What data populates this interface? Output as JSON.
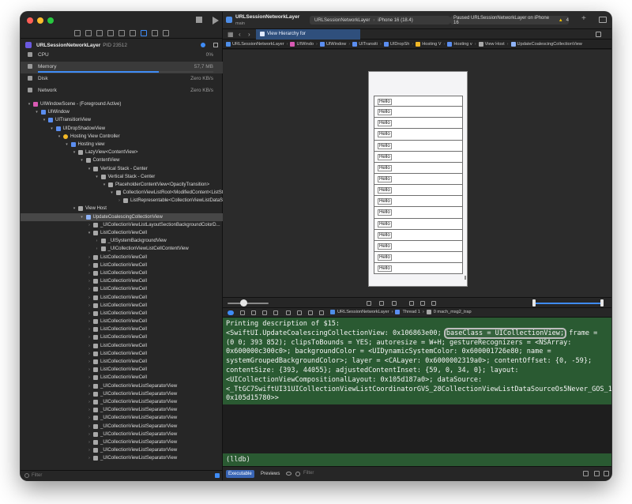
{
  "colors": {
    "accent": "#3f8cf6",
    "console_bg": "#2a5a32",
    "warning": "#f2c200"
  },
  "left": {
    "process": {
      "name": "URLSessionNetworkLayer",
      "pid": "PID 23512"
    },
    "gauges": [
      {
        "label": "CPU",
        "value": "0%",
        "level": 0.0
      },
      {
        "label": "Memory",
        "value": "57,7 MB",
        "level": 0.85
      },
      {
        "label": "Disk",
        "value": "Zero KB/s",
        "level": 0.0
      },
      {
        "label": "Network",
        "value": "Zero KB/s",
        "level": 0.0
      }
    ],
    "tree": [
      {
        "label": "UIWindowScene - (Foreground Active)",
        "depth": 0,
        "open": true,
        "icon": "pink"
      },
      {
        "label": "UIWindow",
        "depth": 1,
        "open": true,
        "icon": "blue"
      },
      {
        "label": "UITransitionView",
        "depth": 2,
        "open": true,
        "icon": "blue"
      },
      {
        "label": "UIDropShadowView",
        "depth": 3,
        "open": true,
        "icon": "blue"
      },
      {
        "label": "Hosting View Controller",
        "depth": 4,
        "open": true,
        "icon": "yellow"
      },
      {
        "label": "Hosting view",
        "depth": 5,
        "open": true,
        "icon": "blue"
      },
      {
        "label": "LazyView<ContentView>",
        "depth": 6,
        "open": true,
        "icon": "gray"
      },
      {
        "label": "ContentView",
        "depth": 7,
        "open": true,
        "icon": "gray"
      },
      {
        "label": "Vertical Stack - Center",
        "depth": 8,
        "open": true,
        "icon": "gray"
      },
      {
        "label": "Vertical Stack - Center",
        "depth": 9,
        "open": true,
        "icon": "gray"
      },
      {
        "label": "PlaceholderContentView<OpacityTransition>",
        "depth": 10,
        "open": true,
        "icon": "gray"
      },
      {
        "label": "CollectionViewListRoot<ModifiedContent<ListSt...",
        "depth": 11,
        "open": true,
        "icon": "gray"
      },
      {
        "label": "ListRepresentable<CollectionViewListDataSo...",
        "depth": 12,
        "open": false,
        "icon": "gray"
      },
      {
        "label": "View Host",
        "depth": 6,
        "open": true,
        "icon": "gray"
      },
      {
        "label": "UpdateCoalescingCollectionView",
        "depth": 7,
        "open": true,
        "icon": "grid",
        "selected": true
      },
      {
        "label": "_UICollectionViewListLayoutSectionBackgroundColorD...",
        "depth": 8,
        "open": false,
        "icon": "gray"
      },
      {
        "label": "ListCollectionViewCell",
        "depth": 8,
        "open": true,
        "icon": "gray"
      },
      {
        "label": "_UISystemBackgroundView",
        "depth": 9,
        "open": false,
        "icon": "gray"
      },
      {
        "label": "_UICollectionViewListCellContentView",
        "depth": 9,
        "open": false,
        "icon": "gray"
      },
      {
        "label": "ListCollectionViewCell",
        "depth": 8,
        "open": false,
        "icon": "gray"
      },
      {
        "label": "ListCollectionViewCell",
        "depth": 8,
        "open": false,
        "icon": "gray"
      },
      {
        "label": "ListCollectionViewCell",
        "depth": 8,
        "open": false,
        "icon": "gray"
      },
      {
        "label": "ListCollectionViewCell",
        "depth": 8,
        "open": false,
        "icon": "gray"
      },
      {
        "label": "ListCollectionViewCell",
        "depth": 8,
        "open": false,
        "icon": "gray"
      },
      {
        "label": "ListCollectionViewCell",
        "depth": 8,
        "open": false,
        "icon": "gray"
      },
      {
        "label": "ListCollectionViewCell",
        "depth": 8,
        "open": false,
        "icon": "gray"
      },
      {
        "label": "ListCollectionViewCell",
        "depth": 8,
        "open": false,
        "icon": "gray"
      },
      {
        "label": "ListCollectionViewCell",
        "depth": 8,
        "open": false,
        "icon": "gray"
      },
      {
        "label": "ListCollectionViewCell",
        "depth": 8,
        "open": false,
        "icon": "gray"
      },
      {
        "label": "ListCollectionViewCell",
        "depth": 8,
        "open": false,
        "icon": "gray"
      },
      {
        "label": "ListCollectionViewCell",
        "depth": 8,
        "open": false,
        "icon": "gray"
      },
      {
        "label": "ListCollectionViewCell",
        "depth": 8,
        "open": false,
        "icon": "gray"
      },
      {
        "label": "ListCollectionViewCell",
        "depth": 8,
        "open": false,
        "icon": "gray"
      },
      {
        "label": "ListCollectionViewCell",
        "depth": 8,
        "open": false,
        "icon": "gray"
      },
      {
        "label": "ListCollectionViewCell",
        "depth": 8,
        "open": false,
        "icon": "gray"
      },
      {
        "label": "_UICollectionViewListSeparatorView",
        "depth": 8,
        "open": false,
        "icon": "gray"
      },
      {
        "label": "_UICollectionViewListSeparatorView",
        "depth": 8,
        "open": false,
        "icon": "gray"
      },
      {
        "label": "_UICollectionViewListSeparatorView",
        "depth": 8,
        "open": false,
        "icon": "gray"
      },
      {
        "label": "_UICollectionViewListSeparatorView",
        "depth": 8,
        "open": false,
        "icon": "gray"
      },
      {
        "label": "_UICollectionViewListSeparatorView",
        "depth": 8,
        "open": false,
        "icon": "gray"
      },
      {
        "label": "_UICollectionViewListSeparatorView",
        "depth": 8,
        "open": false,
        "icon": "gray"
      },
      {
        "label": "_UICollectionViewListSeparatorView",
        "depth": 8,
        "open": false,
        "icon": "gray"
      },
      {
        "label": "_UICollectionViewListSeparatorView",
        "depth": 8,
        "open": false,
        "icon": "gray"
      },
      {
        "label": "_UICollectionViewListSeparatorView",
        "depth": 8,
        "open": false,
        "icon": "gray"
      },
      {
        "label": "_UICollectionViewListSeparatorView",
        "depth": 8,
        "open": false,
        "icon": "gray"
      }
    ],
    "filter_placeholder": "Filter"
  },
  "toolbar": {
    "project": "URLSessionNetworkLayer",
    "branch": "main",
    "scheme": "URLSessionNetworkLayer",
    "device": "iPhone 16 (18.4)",
    "status": "Paused URLSessionNetworkLayer on iPhone 16",
    "warnings": "4"
  },
  "tab": {
    "label": "View Hierarchy for URLSessionNetworkLayer"
  },
  "jumpbar": [
    "URLSessionNetworkLayer",
    "UIWindo",
    "UIWindow",
    "UITransiti",
    "UIDropSh",
    "Hosting V",
    "Hosting v",
    "View Host",
    "UpdateCoalescingCollectionView"
  ],
  "phone": {
    "cells": [
      "Hello",
      "Hello",
      "Hello",
      "Hello",
      "Hello",
      "Hello",
      "Hello",
      "Hello",
      "Hello",
      "Hello",
      "Hello",
      "Hello",
      "Hello",
      "Hello",
      "Hello",
      "Hello"
    ]
  },
  "debugbar": {
    "crumbs": [
      "URLSessionNetworkLayer",
      "Thread 1",
      "0 mach_msg2_trap"
    ]
  },
  "console": {
    "header": "Printing description of $15:",
    "line1_pre": "<SwiftUI.UpdateCoalescingCollectionView: 0x106863e00; ",
    "line1_hl": "baseClass = UICollectionView;",
    "body": "frame = (0 0; 393 852); clipsToBounds = YES; autoresize = W+H; gestureRecognizers = <NSArray: 0x600000c300c0>; backgroundColor = <UIDynamicSystemColor: 0x600001726e80; name = systemGroupedBackgroundColor>; layer = <CALayer: 0x6000002319a0>; contentOffset: {0, -59}; contentSize: {393, 44055}; adjustedContentInset: {59, 0, 34, 0}; layout: <UICollectionViewCompositionalLayout: 0x105d187a0>; dataSource: <_TtGC7SwiftUI31UICollectionViewListCoordinatorGVS_28CollectionViewListDataSourceOs5Never_GOS_19SelectionManagerBoxS2___: 0x105d15780>>",
    "prompt": "(lldb)"
  },
  "bottom": {
    "tabs": [
      "Executable",
      "Previews"
    ],
    "filter_placeholder": "Filter"
  }
}
